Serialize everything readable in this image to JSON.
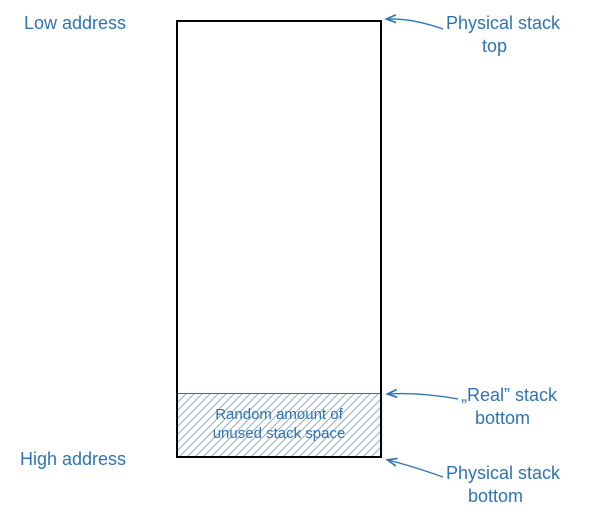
{
  "labels": {
    "low_address": "Low address",
    "high_address": "High address",
    "physical_top_l1": "Physical stack",
    "physical_top_l2": "top",
    "real_bottom_l1": "„Real” stack",
    "real_bottom_l2": "bottom",
    "physical_bottom_l1": "Physical stack",
    "physical_bottom_l2": "bottom",
    "unused_l1": "Random amount of",
    "unused_l2": "unused stack space"
  },
  "colors": {
    "accent": "#2e74b5",
    "box_border": "#000000"
  }
}
